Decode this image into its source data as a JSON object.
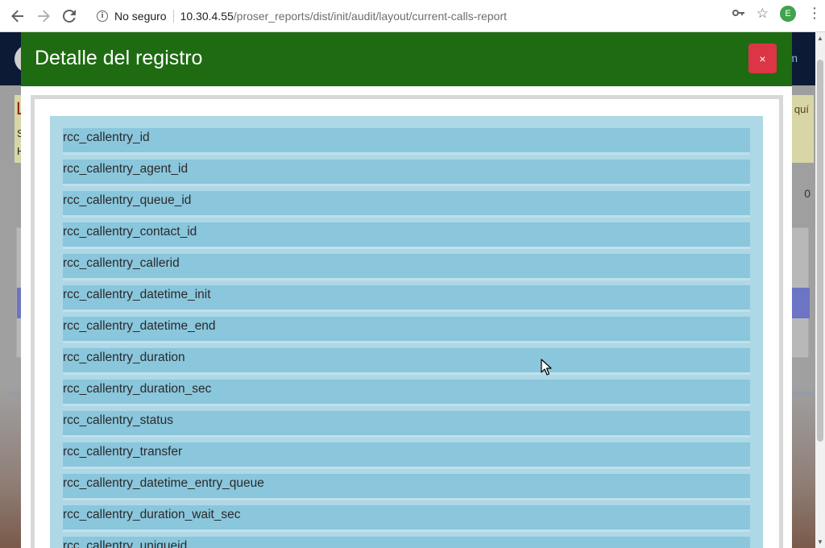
{
  "browser": {
    "back_icon": "arrow-left-icon",
    "forward_icon": "arrow-right-icon",
    "reload_icon": "reload-icon",
    "security_label": "No seguro",
    "url_host": "10.30.4.55",
    "url_path": "/proser_reports/dist/init/audit/layout/current-calls-report",
    "avatar_letter": "E"
  },
  "background_page": {
    "header_right_text": "m",
    "warning_title": "L",
    "warning_line1": "S",
    "warning_line2": "H",
    "warning_right_text": "quí",
    "right_value": "0"
  },
  "modal": {
    "title": "Detalle del registro",
    "close_label": "×",
    "fields": [
      "rcc_callentry_id",
      "rcc_callentry_agent_id",
      "rcc_callentry_queue_id",
      "rcc_callentry_contact_id",
      "rcc_callentry_callerid",
      "rcc_callentry_datetime_init",
      "rcc_callentry_datetime_end",
      "rcc_callentry_duration",
      "rcc_callentry_duration_sec",
      "rcc_callentry_status",
      "rcc_callentry_transfer",
      "rcc_callentry_datetime_entry_queue",
      "rcc_callentry_duration_wait_sec",
      "rcc_callentry_uniqueid"
    ]
  },
  "colors": {
    "modal_header": "#1e6b12",
    "close_button": "#dc3545",
    "panel": "#aed8e6",
    "field_row": "#8ac6dc"
  }
}
